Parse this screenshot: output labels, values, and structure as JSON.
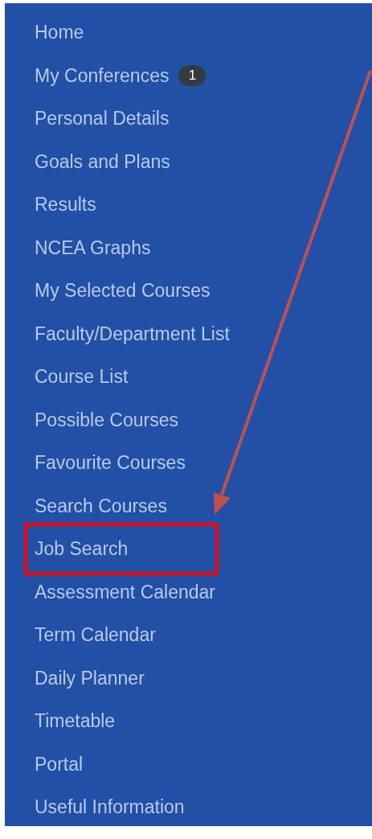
{
  "sidebar": {
    "items": [
      {
        "label": "Home",
        "highlighted": false
      },
      {
        "label": "My Conferences",
        "badge": "1",
        "highlighted": false
      },
      {
        "label": "Personal Details",
        "highlighted": false
      },
      {
        "label": "Goals and Plans",
        "highlighted": false
      },
      {
        "label": "Results",
        "highlighted": false
      },
      {
        "label": "NCEA Graphs",
        "highlighted": false
      },
      {
        "label": "My Selected Courses",
        "highlighted": false
      },
      {
        "label": "Faculty/Department List",
        "highlighted": false
      },
      {
        "label": "Course List",
        "highlighted": false
      },
      {
        "label": "Possible Courses",
        "highlighted": false
      },
      {
        "label": "Favourite Courses",
        "highlighted": false
      },
      {
        "label": "Search Courses",
        "highlighted": false
      },
      {
        "label": "Job Search",
        "highlighted": true
      },
      {
        "label": "Assessment Calendar",
        "highlighted": false
      },
      {
        "label": "Term Calendar",
        "highlighted": false
      },
      {
        "label": "Daily Planner",
        "highlighted": false
      },
      {
        "label": "Timetable",
        "highlighted": false
      },
      {
        "label": "Portal",
        "highlighted": false
      },
      {
        "label": "Useful Information",
        "highlighted": false
      }
    ]
  }
}
